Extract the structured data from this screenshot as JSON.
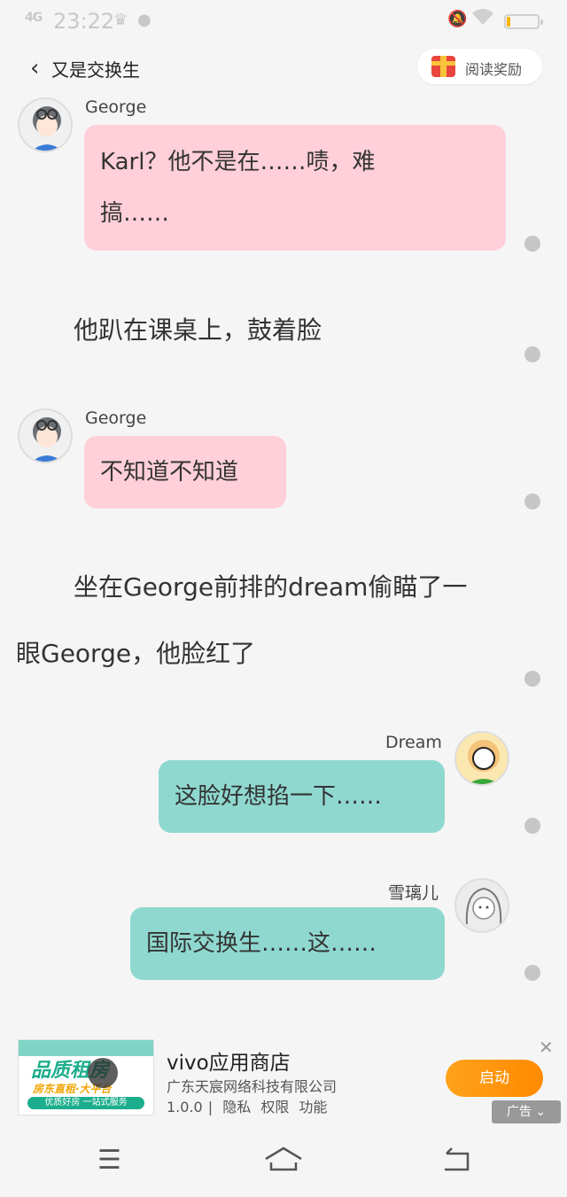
{
  "status_bar": {
    "signal": "4G",
    "time": "23:22",
    "battery_level": 0.12,
    "icons": [
      "crown-icon",
      "message-icon",
      "mute-icon",
      "wifi-icon",
      "battery-icon"
    ]
  },
  "header": {
    "back_icon": "chevron-left-icon",
    "title": "又是交换生",
    "reward_label": "阅读奖励"
  },
  "chat": {
    "msg1": {
      "name": "George",
      "lines": [
        "Karl？他不是在……啧，难",
        "搞……"
      ]
    },
    "narration1": "他趴在课桌上，鼓着脸",
    "msg2": {
      "name": "George",
      "text": "不知道不知道"
    },
    "narration2": [
      "坐在George前排的dream偷瞄了一",
      "眼George，他脸红了"
    ],
    "msg3": {
      "name": "Dream",
      "text": "这脸好想掐一下……"
    },
    "msg4": {
      "name": "雪璃儿",
      "text": "国际交换生……这……"
    }
  },
  "ad": {
    "thumb_title": "品质租房",
    "thumb_sub": "房东直租·大平台",
    "thumb_sub2": "优质好房 一站式服务",
    "app_name": "vivo应用商店",
    "company": "广东天宸网络科技有限公司",
    "version": "1.0.0",
    "privacy": "隐私",
    "permissions": "权限",
    "features": "功能",
    "launch_label": "启动",
    "tag_label": "广告"
  },
  "bottom_nav": {
    "icons": [
      "menu-icon",
      "home-icon",
      "back-icon"
    ]
  },
  "colors": {
    "pink_bubble": "#ffcfda",
    "teal_bubble": "#8fd8cf",
    "accent": "#ff8a00"
  }
}
